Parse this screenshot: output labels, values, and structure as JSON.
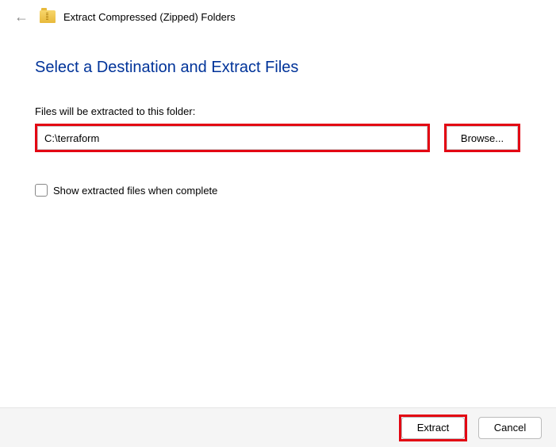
{
  "header": {
    "title": "Extract Compressed (Zipped) Folders"
  },
  "main": {
    "heading": "Select a Destination and Extract Files",
    "field_label": "Files will be extracted to this folder:",
    "path_value": "C:\\terraform",
    "browse_label": "Browse...",
    "checkbox_label": "Show extracted files when complete"
  },
  "footer": {
    "extract_label": "Extract",
    "cancel_label": "Cancel"
  },
  "highlights": {
    "path_input": "#e30613",
    "browse_button": "#e30613",
    "extract_button": "#e30613"
  }
}
